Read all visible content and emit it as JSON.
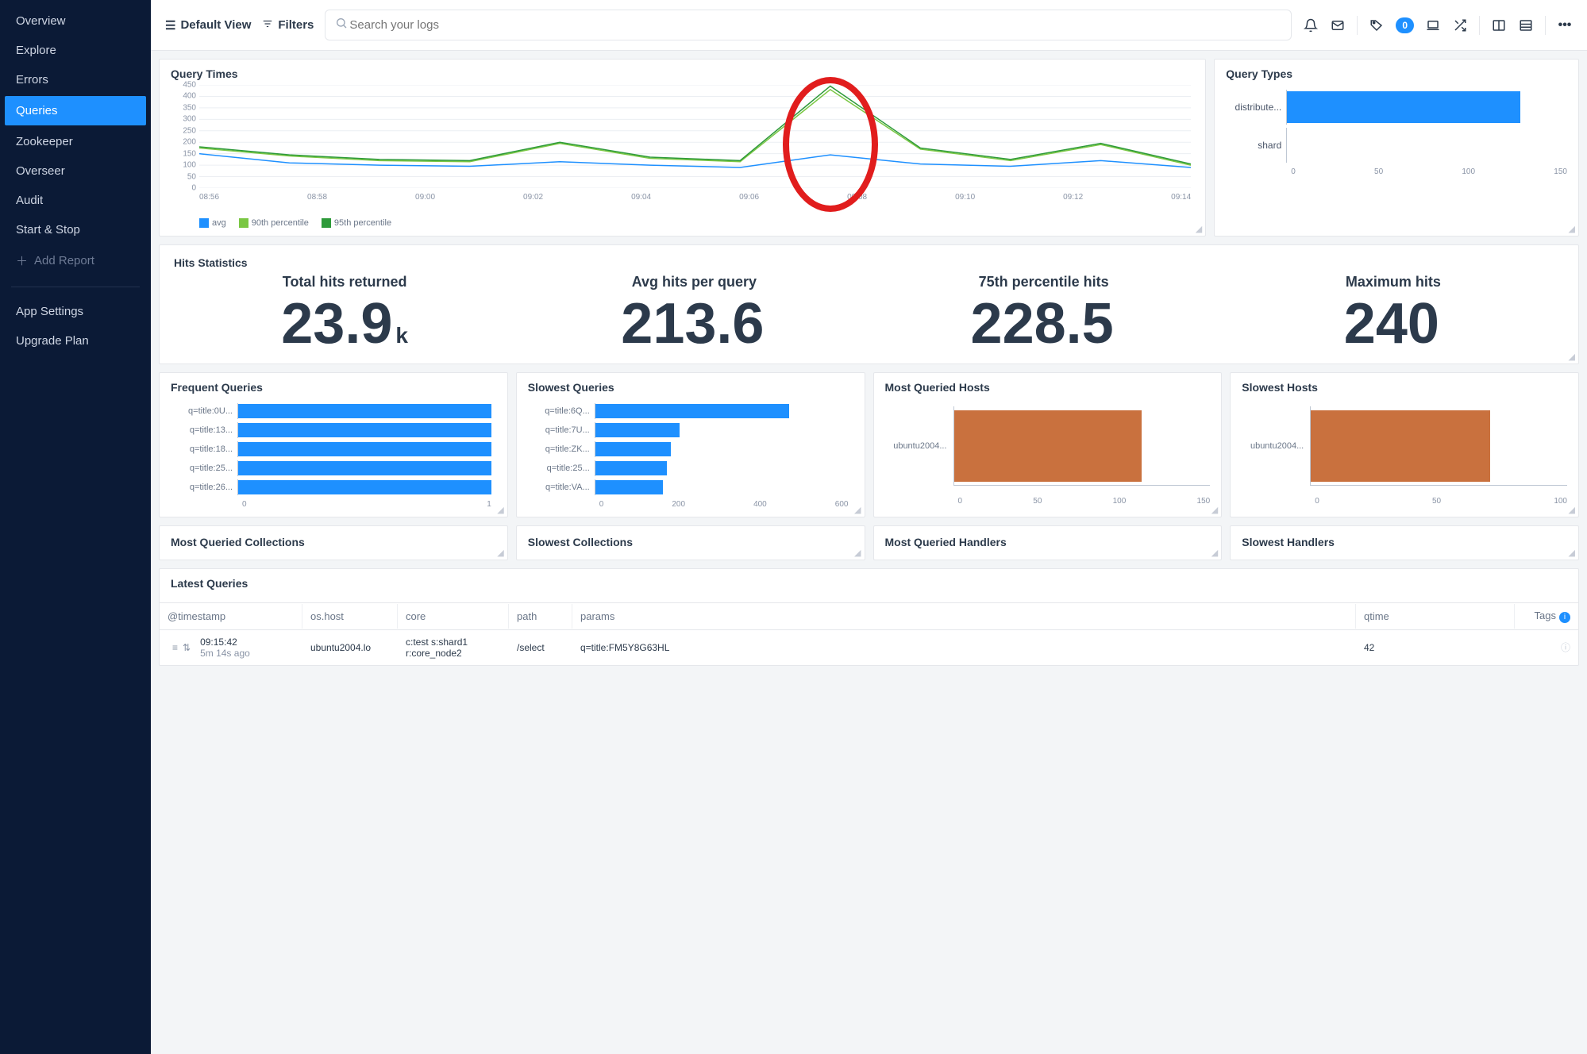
{
  "sidebar": {
    "items": [
      {
        "label": "Overview"
      },
      {
        "label": "Explore"
      },
      {
        "label": "Errors"
      },
      {
        "label": "Queries",
        "active": true
      },
      {
        "label": "Zookeeper"
      },
      {
        "label": "Overseer"
      },
      {
        "label": "Audit"
      },
      {
        "label": "Start & Stop"
      }
    ],
    "add_report": "Add Report",
    "footer": [
      {
        "label": "App Settings"
      },
      {
        "label": "Upgrade Plan"
      }
    ]
  },
  "topbar": {
    "default_view": "Default View",
    "filters": "Filters",
    "search_placeholder": "Search your logs",
    "badge": "0"
  },
  "query_times": {
    "title": "Query Times",
    "legend": {
      "avg": "avg",
      "p90": "90th percentile",
      "p95": "95th percentile"
    }
  },
  "query_types": {
    "title": "Query Types"
  },
  "hits_stats": {
    "title": "Hits Statistics",
    "items": [
      {
        "label": "Total hits returned",
        "value": "23.9",
        "suffix": "k"
      },
      {
        "label": "Avg hits per query",
        "value": "213.6",
        "suffix": ""
      },
      {
        "label": "75th percentile hits",
        "value": "228.5",
        "suffix": ""
      },
      {
        "label": "Maximum hits",
        "value": "240",
        "suffix": ""
      }
    ]
  },
  "mini_titles": {
    "frequent": "Frequent Queries",
    "slowest_q": "Slowest Queries",
    "most_hosts": "Most Queried Hosts",
    "slow_hosts": "Slowest Hosts",
    "most_coll": "Most Queried Collections",
    "slow_coll": "Slowest Collections",
    "most_hand": "Most Queried Handlers",
    "slow_hand": "Slowest Handlers"
  },
  "latest": {
    "title": "Latest Queries",
    "columns": {
      "ts": "@timestamp",
      "host": "os.host",
      "core": "core",
      "path": "path",
      "params": "params",
      "qtime": "qtime",
      "tags": "Tags"
    },
    "row": {
      "ts1": "09:15:42",
      "ts2": "5m 14s ago",
      "host": "ubuntu2004.lo",
      "core1": "c:test s:shard1",
      "core2": "r:core_node2",
      "path": "/select",
      "params": "q=title:FM5Y8G63HL",
      "qtime": "42"
    }
  },
  "chart_data": [
    {
      "id": "query_times",
      "type": "line",
      "title": "Query Times",
      "xlabel": "",
      "ylabel": "",
      "ylim": [
        0,
        450
      ],
      "yticks": [
        0,
        50,
        100,
        150,
        200,
        250,
        300,
        350,
        400,
        450
      ],
      "x": [
        "08:56",
        "08:58",
        "09:00",
        "09:02",
        "09:04",
        "09:06",
        "09:08",
        "09:10",
        "09:12",
        "09:14"
      ],
      "series": [
        {
          "name": "avg",
          "color": "#1e90ff",
          "values": [
            150,
            110,
            100,
            95,
            115,
            100,
            90,
            145,
            105,
            95,
            120,
            90
          ]
        },
        {
          "name": "90th percentile",
          "color": "#7ac743",
          "values": [
            175,
            140,
            120,
            115,
            195,
            130,
            115,
            430,
            170,
            120,
            190,
            100
          ]
        },
        {
          "name": "95th percentile",
          "color": "#2e9a3a",
          "values": [
            180,
            145,
            125,
            120,
            200,
            135,
            120,
            445,
            175,
            125,
            195,
            105
          ]
        }
      ],
      "annotation": {
        "type": "circle",
        "x": "09:08",
        "note": "spike circled in red"
      }
    },
    {
      "id": "query_types",
      "type": "bar",
      "orientation": "horizontal",
      "title": "Query Types",
      "categories": [
        "distribute...",
        "shard"
      ],
      "values": [
        125,
        0
      ],
      "xlim": [
        0,
        150
      ],
      "xticks": [
        0,
        50,
        100,
        150
      ],
      "color": "#1e90ff"
    },
    {
      "id": "frequent_queries",
      "type": "bar",
      "orientation": "horizontal",
      "title": "Frequent Queries",
      "categories": [
        "q=title:0U...",
        "q=title:13...",
        "q=title:18...",
        "q=title:25...",
        "q=title:26..."
      ],
      "values": [
        1,
        1,
        1,
        1,
        1
      ],
      "xlim": [
        0,
        1
      ],
      "xticks": [
        0,
        1
      ],
      "color": "#1e90ff"
    },
    {
      "id": "slowest_queries",
      "type": "bar",
      "orientation": "horizontal",
      "title": "Slowest Queries",
      "categories": [
        "q=title:6Q...",
        "q=title:7U...",
        "q=title:ZK...",
        "q=title:25...",
        "q=title:VA..."
      ],
      "values": [
        460,
        200,
        180,
        170,
        160
      ],
      "xlim": [
        0,
        600
      ],
      "xticks": [
        0,
        200,
        400,
        600
      ],
      "color": "#1e90ff"
    },
    {
      "id": "most_queried_hosts",
      "type": "bar",
      "orientation": "horizontal",
      "title": "Most Queried Hosts",
      "categories": [
        "ubuntu2004..."
      ],
      "values": [
        110
      ],
      "xlim": [
        0,
        150
      ],
      "xticks": [
        0,
        50,
        100,
        150
      ],
      "color": "#c9713e"
    },
    {
      "id": "slowest_hosts",
      "type": "bar",
      "orientation": "horizontal",
      "title": "Slowest Hosts",
      "categories": [
        "ubuntu2004..."
      ],
      "values": [
        70
      ],
      "xlim": [
        0,
        100
      ],
      "xticks": [
        0,
        50,
        100
      ],
      "color": "#c9713e"
    }
  ]
}
